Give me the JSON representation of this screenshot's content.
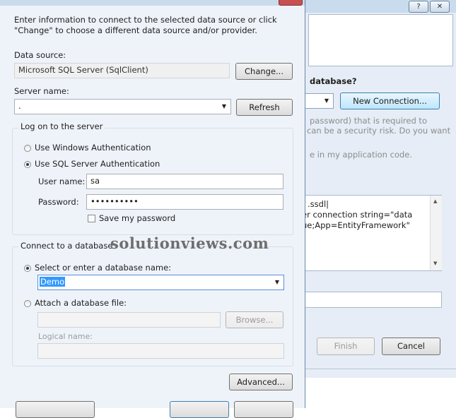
{
  "background_window": {
    "title_buttons": {
      "help": "?",
      "close": "✕"
    },
    "question": "database?",
    "new_connection_button": "New Connection...",
    "text_line1": "password) that is required to",
    "text_line2": "can be a security risk. Do you want",
    "text_line3": "e in my application code.",
    "conn_line1": ".ssdl|",
    "conn_line2": "er connection string=\"data",
    "conn_line3": "ue;App=EntityFramework\"",
    "finish_button": "Finish",
    "cancel_button": "Cancel"
  },
  "dialog": {
    "intro": "Enter information to connect to the selected data source or click \"Change\" to choose a different data source and/or provider.",
    "data_source_label": "Data source:",
    "data_source_value": "Microsoft SQL Server (SqlClient)",
    "change_button": "Change...",
    "server_name_label": "Server name:",
    "server_name_value": ".",
    "refresh_button": "Refresh",
    "logon_group": {
      "title": "Log on to the server",
      "windows_auth": "Use Windows Authentication",
      "sql_auth": "Use SQL Server Authentication",
      "selected": "sql_auth",
      "username_label": "User name:",
      "username_value": "sa",
      "password_label": "Password:",
      "password_value": "••••••••••",
      "save_password_label": "Save my password",
      "save_password_checked": false
    },
    "connect_group": {
      "title": "Connect to a database",
      "select_db_label": "Select or enter a database name:",
      "db_value": "Demo",
      "attach_label": "Attach a database file:",
      "browse_button": "Browse...",
      "logical_name_label": "Logical name:",
      "selected": "select_db"
    },
    "advanced_button": "Advanced..."
  },
  "watermark": "solutionviews.com",
  "icons": {
    "dropdown": "chevron-down-icon",
    "scroll_up": "arrow-up-icon",
    "scroll_down": "arrow-down-icon"
  },
  "colors": {
    "selection": "#3399ff",
    "dialog_bg": "#eef3fa",
    "titlebar": "#c9dced"
  }
}
